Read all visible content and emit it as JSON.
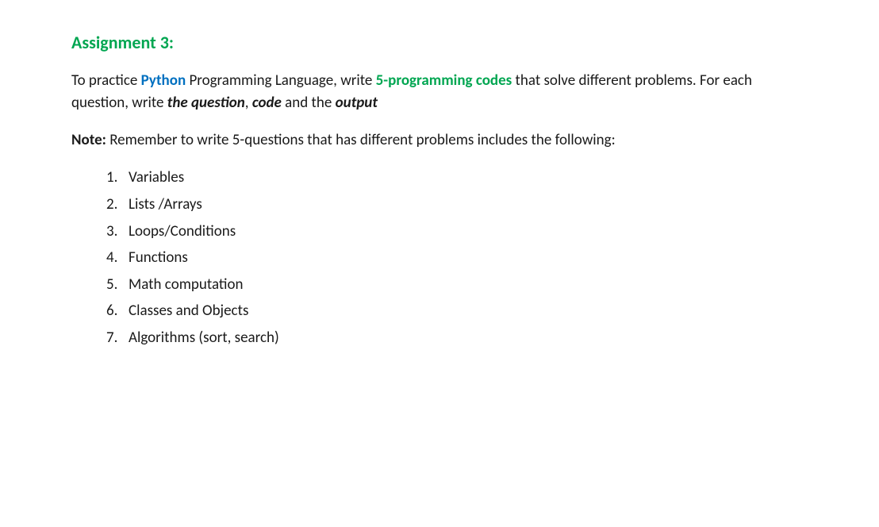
{
  "title": "Assignment 3:",
  "intro": {
    "p1a": "To practice ",
    "python": "Python",
    "p1b": " Programming Language, write ",
    "five_codes": "5-programming codes",
    "p1c": " that solve different problems. For each question, write ",
    "the_question": "the question",
    "comma1": ", ",
    "code": "code",
    "p1d": " and the ",
    "output": "output"
  },
  "note": {
    "label": "Note:",
    "text": " Remember to write 5-questions that has different problems includes the following:"
  },
  "items": [
    {
      "n": "1.",
      "t": "Variables"
    },
    {
      "n": "2.",
      "t": "Lists /Arrays"
    },
    {
      "n": "3.",
      "t": "Loops/Conditions"
    },
    {
      "n": "4.",
      "t": "Functions"
    },
    {
      "n": "5.",
      "t": "Math computation"
    },
    {
      "n": "6.",
      "t": "Classes and Objects"
    },
    {
      "n": "7.",
      "t": "Algorithms (sort, search)"
    }
  ]
}
